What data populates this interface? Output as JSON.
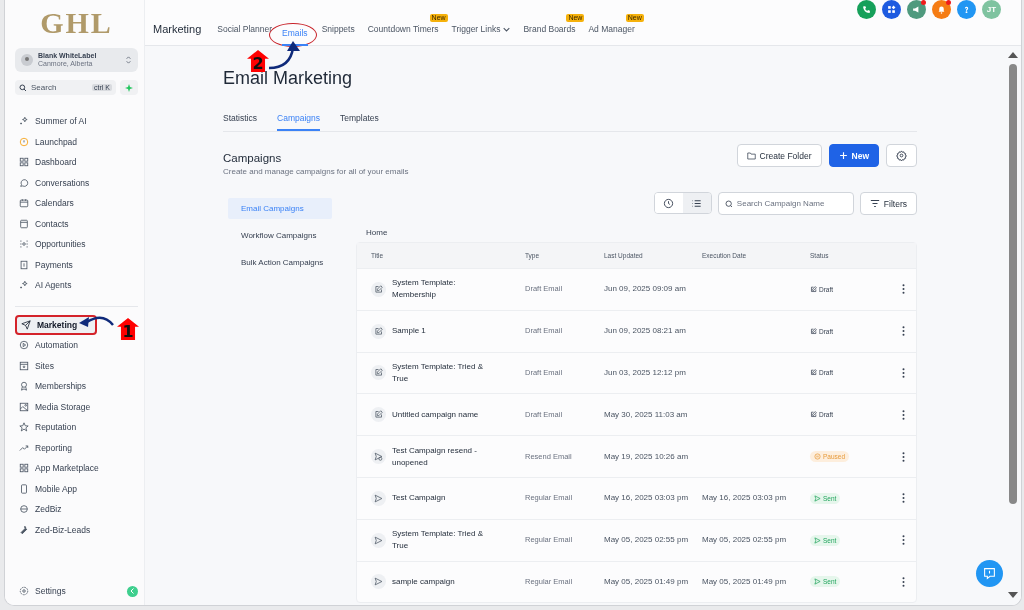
{
  "logo": "GHL",
  "account": {
    "name": "Blank WhiteLabel",
    "location": "Canmore, Alberta"
  },
  "search": {
    "placeholder": "Search",
    "shortcut": "ctrl K"
  },
  "nav": [
    {
      "label": "Summer of AI",
      "selected": false
    },
    {
      "label": "Launchpad",
      "selected": false
    },
    {
      "label": "Dashboard",
      "selected": false
    },
    {
      "label": "Conversations",
      "selected": false
    },
    {
      "label": "Calendars",
      "selected": false
    },
    {
      "label": "Contacts",
      "selected": false
    },
    {
      "label": "Opportunities",
      "selected": false
    },
    {
      "label": "Payments",
      "selected": false
    },
    {
      "label": "AI Agents",
      "selected": false
    },
    {
      "label": "Marketing",
      "selected": true,
      "divider_before": true,
      "highlighted": true
    },
    {
      "label": "Automation",
      "selected": false
    },
    {
      "label": "Sites",
      "selected": false
    },
    {
      "label": "Memberships",
      "selected": false
    },
    {
      "label": "Media Storage",
      "selected": false
    },
    {
      "label": "Reputation",
      "selected": false
    },
    {
      "label": "Reporting",
      "selected": false
    },
    {
      "label": "App Marketplace",
      "selected": false
    },
    {
      "label": "Mobile App",
      "selected": false
    },
    {
      "label": "ZedBiz",
      "selected": false
    },
    {
      "label": "Zed-Biz-Leads",
      "selected": false
    }
  ],
  "settings": {
    "label": "Settings"
  },
  "topbar": {
    "section": "Marketing",
    "tabs": [
      {
        "label": "Social Planner",
        "selected": false
      },
      {
        "label": "Emails",
        "selected": true,
        "highlighted": true
      },
      {
        "label": "Snippets",
        "selected": false
      },
      {
        "label": "Countdown Timers",
        "selected": false,
        "badge": "New"
      },
      {
        "label": "Trigger Links",
        "selected": false,
        "dropdown": true
      },
      {
        "label": "Brand Boards",
        "selected": false,
        "badge": "New"
      },
      {
        "label": "Ad Manager",
        "selected": false,
        "badge": "New"
      }
    ],
    "icons": [
      {
        "kind": "phone",
        "color": "#16a05a"
      },
      {
        "kind": "apps",
        "color": "#1e5be0"
      },
      {
        "kind": "megaphone",
        "color": "#4f9a7e",
        "dot": true
      },
      {
        "kind": "bell",
        "color": "#f57c14",
        "dot": true
      },
      {
        "kind": "help",
        "color": "#2196f3"
      }
    ],
    "avatar": "JT"
  },
  "page": {
    "title": "Email Marketing",
    "tabs": [
      {
        "label": "Statistics",
        "selected": false
      },
      {
        "label": "Campaigns",
        "selected": true
      },
      {
        "label": "Templates",
        "selected": false
      }
    ],
    "heading": "Campaigns",
    "subheading": "Create and manage campaigns for all of your emails",
    "create_folder": "Create Folder",
    "new": "New",
    "subnav": [
      {
        "label": "Email Campaigns",
        "selected": true
      },
      {
        "label": "Workflow Campaigns",
        "selected": false
      },
      {
        "label": "Bulk Action Campaigns",
        "selected": false
      }
    ],
    "view_toggle": [
      {
        "kind": "clock",
        "selected": false
      },
      {
        "kind": "list",
        "selected": true
      }
    ],
    "campaign_search": {
      "placeholder": "Search Campaign Name"
    },
    "filters": "Filters",
    "breadcrumb": "Home",
    "table": {
      "columns": [
        "Title",
        "Type",
        "Last Updated",
        "Execution Date",
        "Status"
      ],
      "rows": [
        {
          "kind": "draft",
          "title": "System Template: Membership",
          "type": "Draft Email",
          "last_updated": "Jun 09, 2025 09:09 am",
          "status": "Draft"
        },
        {
          "kind": "draft",
          "title": "Sample 1",
          "type": "Draft Email",
          "last_updated": "Jun 09, 2025 08:21 am",
          "status": "Draft"
        },
        {
          "kind": "draft",
          "title": "System Template: Tried & True",
          "type": "Draft Email",
          "last_updated": "Jun 03, 2025 12:12 pm",
          "status": "Draft"
        },
        {
          "kind": "draft",
          "title": "Untitled campaign name",
          "type": "Draft Email",
          "last_updated": "May 30, 2025 11:03 am",
          "status": "Draft"
        },
        {
          "kind": "paused",
          "title": "Test Campaign resend - unopened",
          "type": "Resend Email",
          "last_updated": "May 19, 2025 10:26 am",
          "status": "Paused"
        },
        {
          "kind": "sent",
          "title": "Test Campaign",
          "type": "Regular Email",
          "last_updated": "May 16, 2025 03:03 pm",
          "execution_date": "May 16, 2025 03:03 pm",
          "status": "Sent"
        },
        {
          "kind": "sent",
          "title": "System Template: Tried & True",
          "type": "Regular Email",
          "last_updated": "May 05, 2025 02:55 pm",
          "execution_date": "May 05, 2025 02:55 pm",
          "status": "Sent"
        },
        {
          "kind": "sent",
          "title": "sample campaign",
          "type": "Regular Email",
          "last_updated": "May 05, 2025 01:49 pm",
          "execution_date": "May 05, 2025 01:49 pm",
          "status": "Sent"
        }
      ]
    }
  },
  "annotations": [
    {
      "label": "1"
    },
    {
      "label": "2"
    }
  ]
}
